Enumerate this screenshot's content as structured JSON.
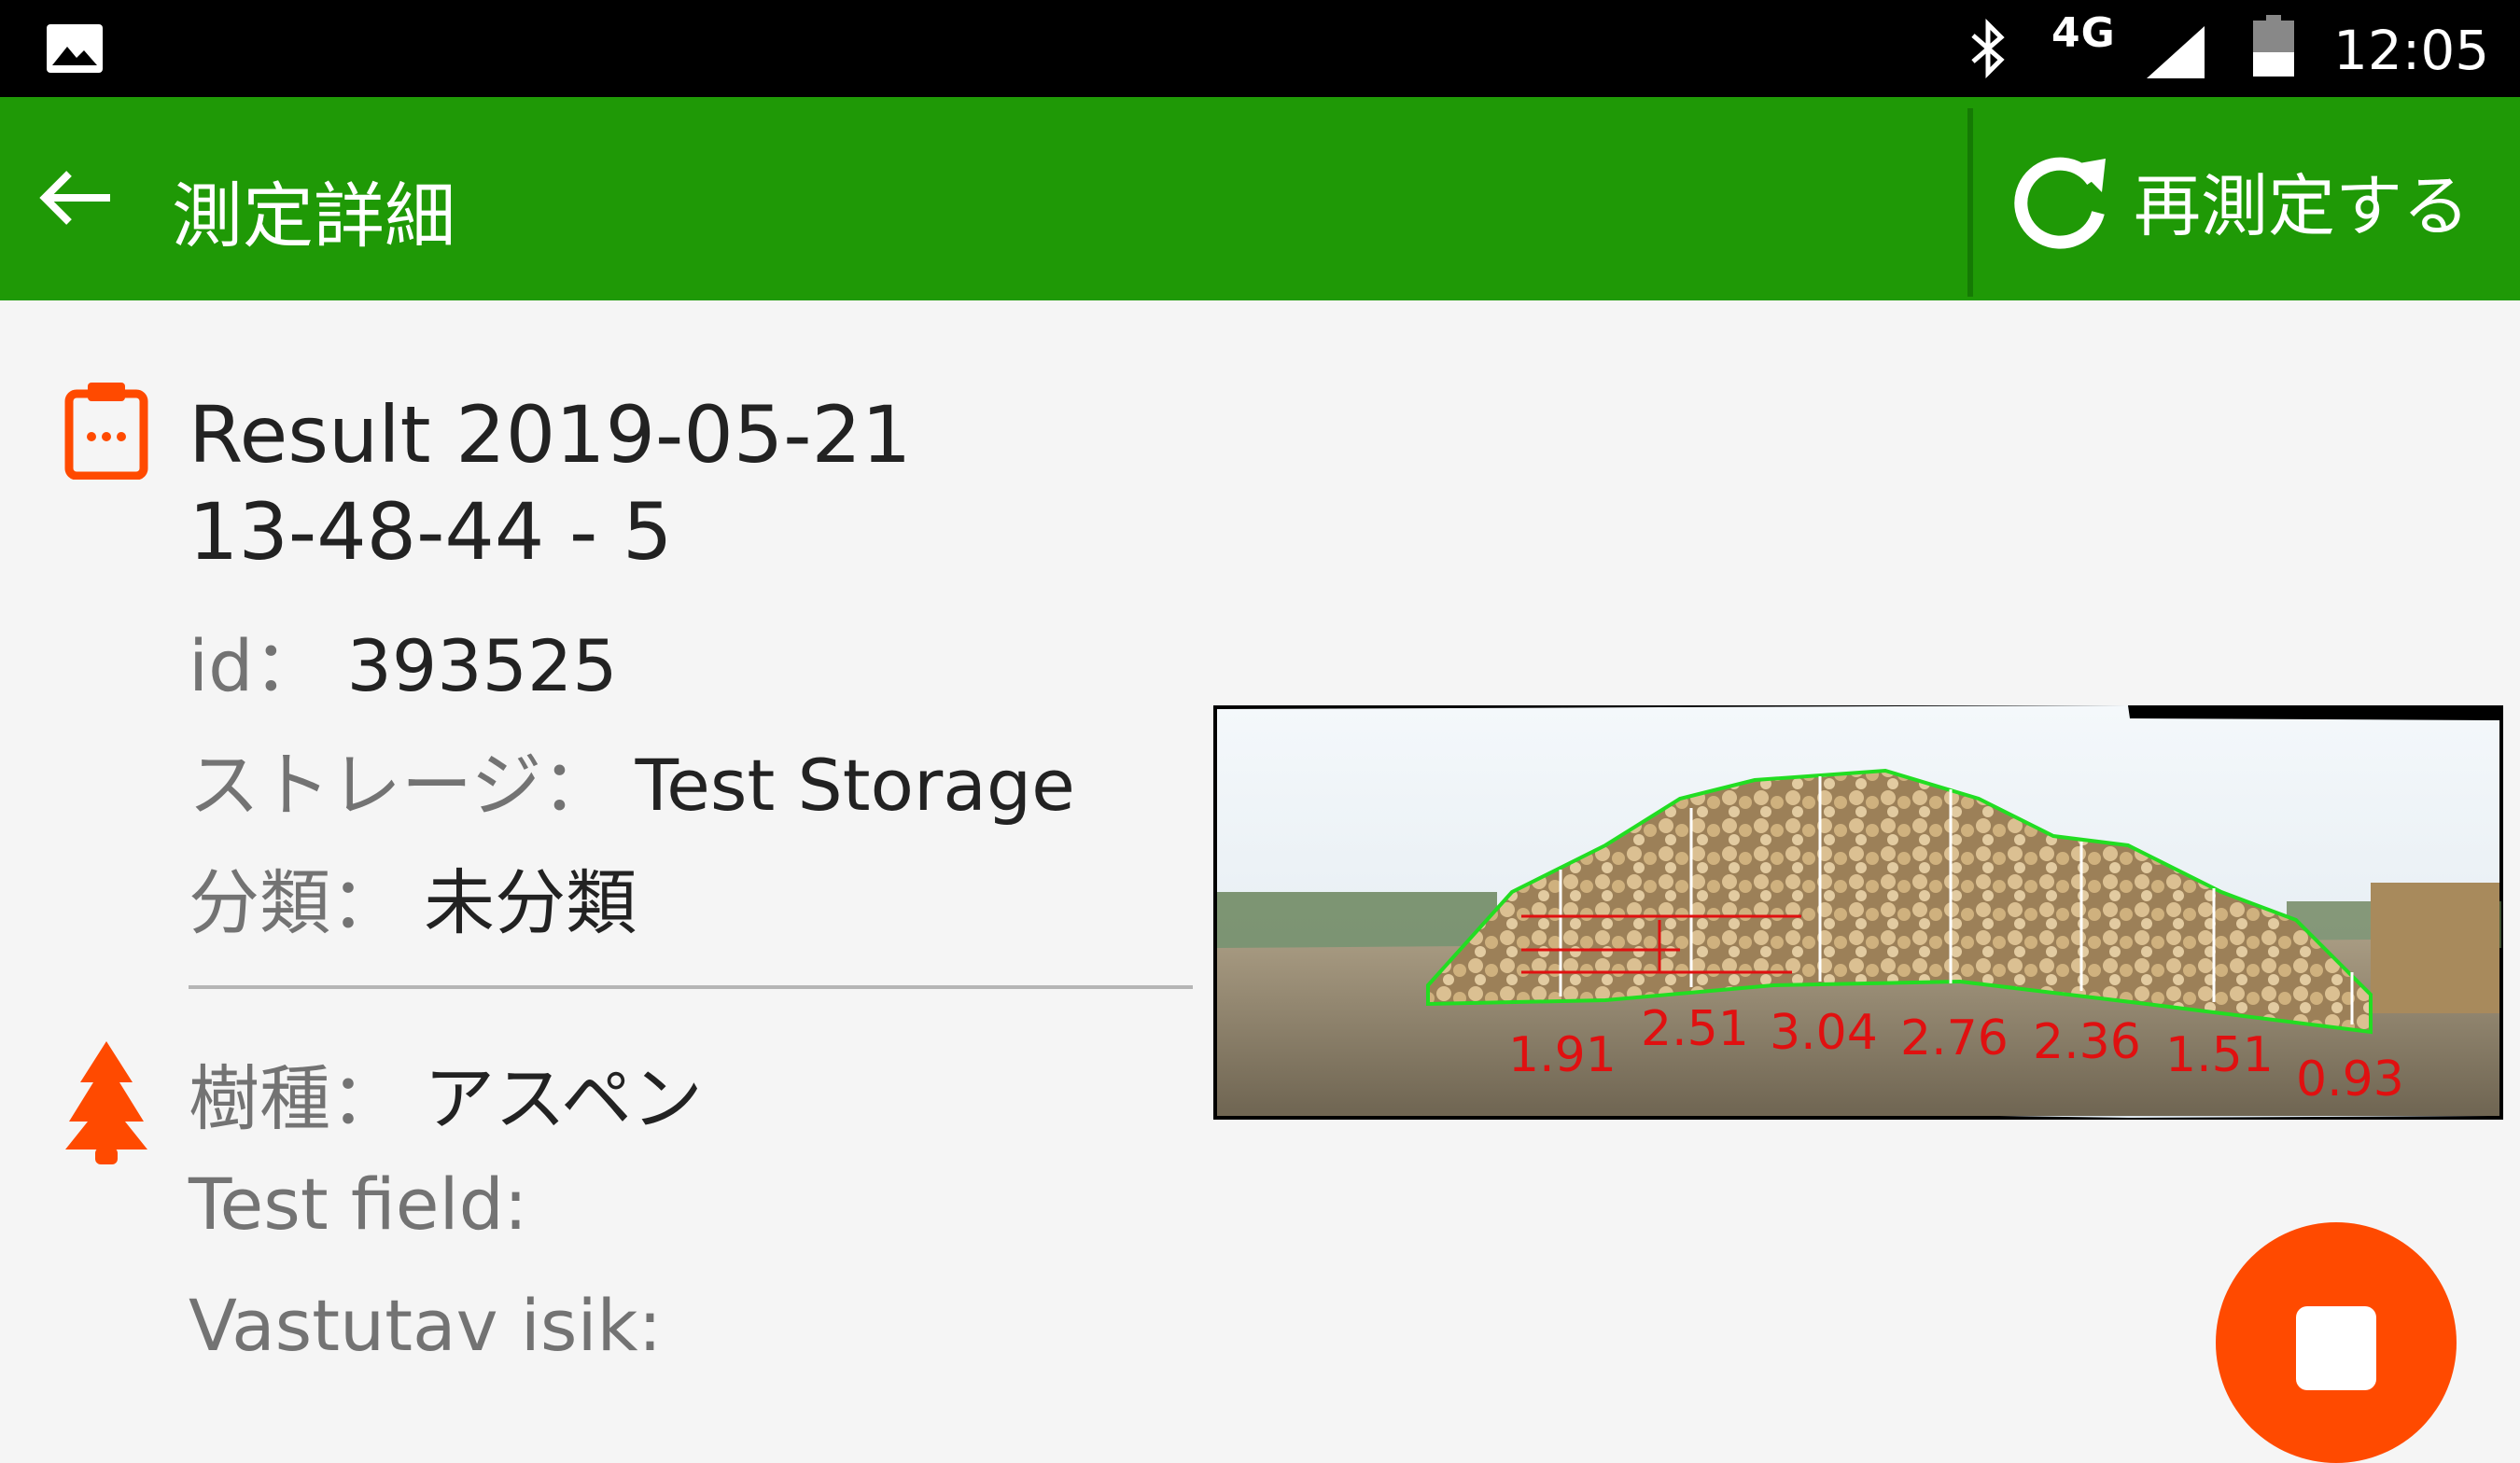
{
  "status_bar": {
    "network": "4G",
    "time": "12:05",
    "icons": [
      "image-notification-icon",
      "bluetooth-icon",
      "cell-signal-icon",
      "battery-icon"
    ]
  },
  "app_bar": {
    "title": "測定詳細",
    "action_label": "再測定する",
    "icons": [
      "back-arrow-icon",
      "refresh-icon"
    ]
  },
  "result": {
    "title_line1": "Result 2019-05-21",
    "title_line2": "13-48-44 - 5",
    "id_label": "id：",
    "id_value": "393525",
    "storage_label": "ストレージ：",
    "storage_value": "Test Storage",
    "class_label": "分類：",
    "class_value": "未分類"
  },
  "details": {
    "species_label": "樹種：",
    "species_value": "アスペン",
    "test_field_label": "Test field:",
    "vastutav_label": "Vastutav isik:"
  },
  "measurement_image": {
    "section_heights": [
      "1.91",
      "2.51",
      "3.04",
      "2.76",
      "2.36",
      "1.51",
      "0.93"
    ]
  },
  "colors": {
    "app_bar": "#1f9906",
    "accent": "#ff4a00",
    "outline": "#22dd22",
    "height_labels": "#e01010"
  }
}
